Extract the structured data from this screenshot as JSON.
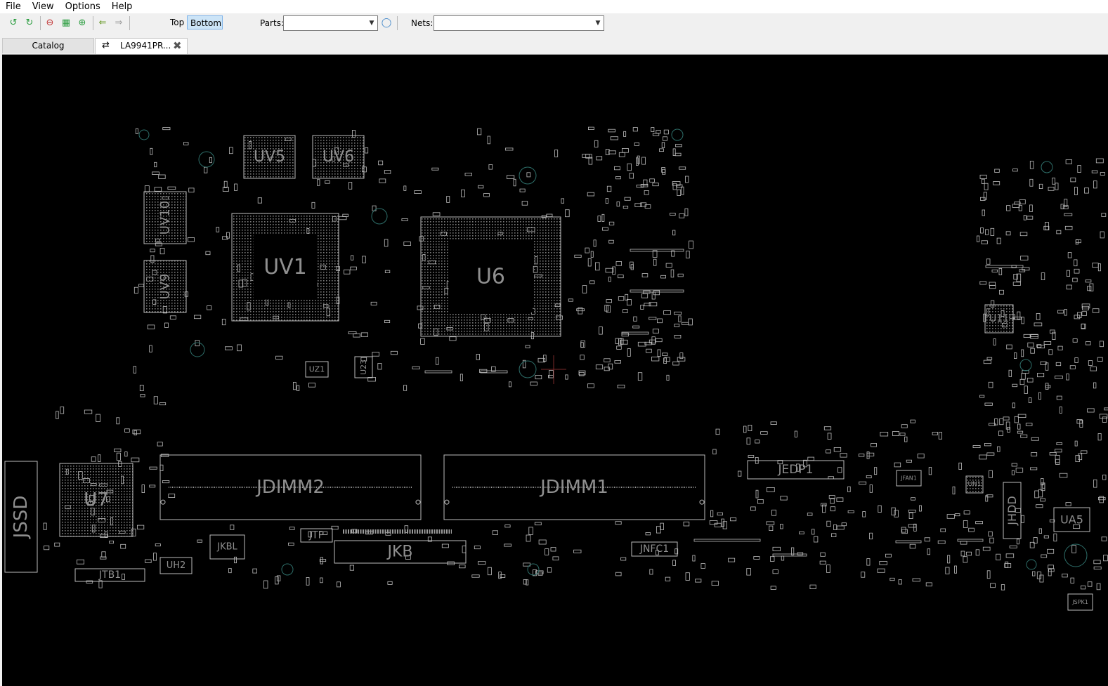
{
  "menu": [
    "File",
    "View",
    "Options",
    "Help"
  ],
  "toolbar": {
    "icons": [
      "rotate-left-icon",
      "rotate-right-icon",
      "zoom-out-icon",
      "zoom-fit-icon",
      "zoom-in-icon",
      "back-arrow-icon",
      "forward-arrow-icon"
    ],
    "top_label": "Top",
    "bottom_label": "Bottom",
    "active_side": "Bottom",
    "parts_label": "Parts:",
    "parts_value": "",
    "nets_label": "Nets:",
    "nets_value": ""
  },
  "tabs": [
    {
      "label": "Catalog",
      "active": false
    },
    {
      "label": "LA9941PR...",
      "active": true
    }
  ],
  "board": {
    "background": "#000000",
    "outline_color": "#bdbdbd",
    "label_color": "#8f8f8f",
    "components": [
      "UV5",
      "UV6",
      "UV10",
      "UV9",
      "UV1",
      "U6",
      "UZ1",
      "U23",
      "U7",
      "JSSD",
      "JDIMM2",
      "JDIMM1",
      "JKBL",
      "JTP",
      "JKB",
      "JTB1",
      "UH2",
      "JNFC1",
      "JEDP1",
      "JFAN1",
      "JHDD",
      "UA5",
      "U11",
      "UN1",
      "JSPK1"
    ]
  }
}
